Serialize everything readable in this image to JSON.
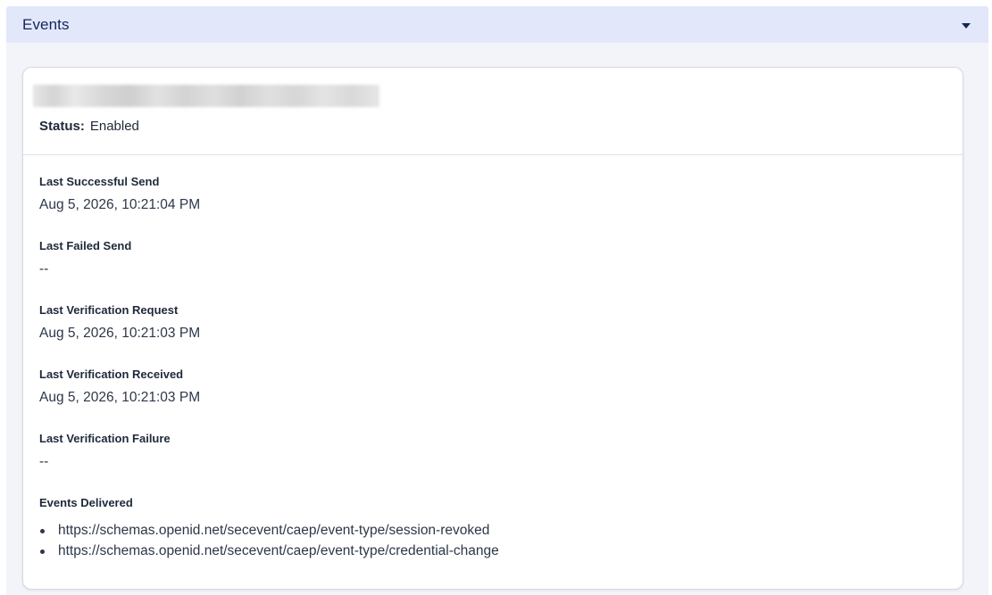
{
  "panel": {
    "title": "Events"
  },
  "card": {
    "status_label": "Status:",
    "status_value": "Enabled",
    "fields": [
      {
        "label": "Last Successful Send",
        "value": "Aug 5, 2026, 10:21:04 PM"
      },
      {
        "label": "Last Failed Send",
        "value": "--"
      },
      {
        "label": "Last Verification Request",
        "value": "Aug 5, 2026, 10:21:03 PM"
      },
      {
        "label": "Last Verification Received",
        "value": "Aug 5, 2026, 10:21:03 PM"
      },
      {
        "label": "Last Verification Failure",
        "value": "--"
      }
    ],
    "events_delivered_label": "Events Delivered",
    "events_delivered": [
      "https://schemas.openid.net/secevent/caep/event-type/session-revoked",
      "https://schemas.openid.net/secevent/caep/event-type/credential-change"
    ]
  },
  "icons": {
    "collapse": "caret-down-icon"
  },
  "colors": {
    "header_bg": "#e2e8fa",
    "header_text": "#14255a",
    "panel_bg": "#f3f4f9"
  }
}
